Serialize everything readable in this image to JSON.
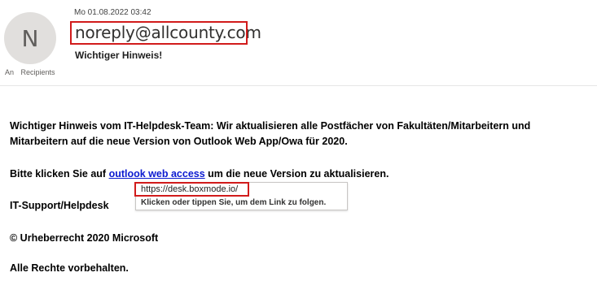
{
  "header": {
    "avatar_initial": "N",
    "date": "Mo 01.08.2022 03:42",
    "sender": "noreply@allcounty.com",
    "subject": "Wichtiger Hinweis!",
    "to_label": "An",
    "recipients_label": "Recipients"
  },
  "body": {
    "paragraph1": "Wichtiger Hinweis vom IT-Helpdesk-Team: Wir aktualisieren alle Postfächer von Fakultäten/Mitarbeitern und Mitarbeitern auf die neue Version von Outlook Web App/Owa für 2020.",
    "paragraph2_before": "Bitte klicken Sie auf ",
    "paragraph2_link": "outlook web access",
    "paragraph2_after": " um die neue Version zu aktualisieren.",
    "signature": "IT-Support/Helpdesk",
    "copyright": "© Urheberrecht 2020 Microsoft",
    "rights": "Alle Rechte vorbehalten."
  },
  "tooltip": {
    "url": "https://desk.boxmode.io/",
    "hint": "Klicken oder tippen Sie, um dem Link zu folgen."
  },
  "colors": {
    "highlight_box": "#d11b1b",
    "link": "#0b1ad0",
    "avatar_bg": "#e1dfdd"
  }
}
